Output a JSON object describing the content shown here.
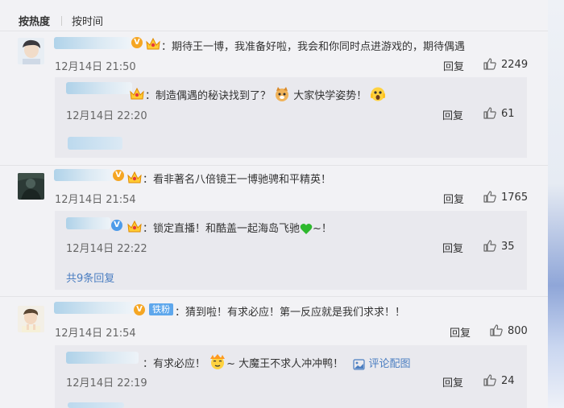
{
  "sort": {
    "hot": "按热度",
    "time": "按时间"
  },
  "comments": [
    {
      "text": "：期待王一博，我准备好啦，我会和你同时点进游戏的，期待偶遇",
      "time": "12月14日 21:50",
      "reply": "回复",
      "likes": "2249",
      "sub": {
        "text_a": "：制造偶遇的秘诀找到了？",
        "text_b": "大家快学姿势！",
        "time": "12月14日 22:20",
        "reply": "回复",
        "likes": "61"
      }
    },
    {
      "text": "：看非著名八倍镜王一博驰骋和平精英！",
      "time": "12月14日 21:54",
      "reply": "回复",
      "likes": "1765",
      "sub": {
        "text_a": "：锁定直播！和酷盖一起海岛飞驰",
        "text_b": "~！",
        "time": "12月14日 22:22",
        "reply": "回复",
        "likes": "35"
      },
      "more": "共9条回复"
    },
    {
      "fan_badge": "铁粉",
      "text": "：猜到啦！有求必应！第一反应就是我们求求！！",
      "time": "12月14日 21:54",
      "reply": "回复",
      "likes": "800",
      "sub": {
        "text_a": "：有求必应！",
        "text_b": "~ 大魔王不求人冲冲鸭！",
        "pic_link": "评论配图",
        "time": "12月14日 22:19",
        "reply": "回复",
        "likes": "24"
      }
    }
  ]
}
